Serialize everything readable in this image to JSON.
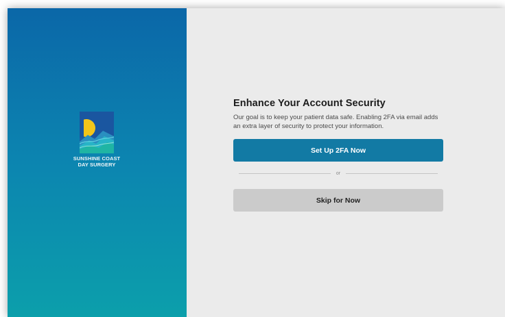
{
  "brand": {
    "logo_line1": "SUNSHINE COAST",
    "logo_line2": "DAY SURGERY",
    "logo_icon": "sunshine-coast-logo-icon",
    "colors": {
      "panel_top": "#0b67a8",
      "panel_bottom": "#0c9fab",
      "sun": "#f3c51a",
      "sea": "#1fb5a4"
    }
  },
  "security": {
    "title": "Enhance Your Account Security",
    "description": "Our goal is to keep your patient data safe. Enabling 2FA via email adds an extra layer of security to protect your information.",
    "primary_label": "Set Up 2FA Now",
    "divider_label": "or",
    "secondary_label": "Skip for Now",
    "colors": {
      "primary_button": "#127aa4",
      "secondary_button": "#cbcbcb",
      "background": "#ebebeb"
    }
  }
}
